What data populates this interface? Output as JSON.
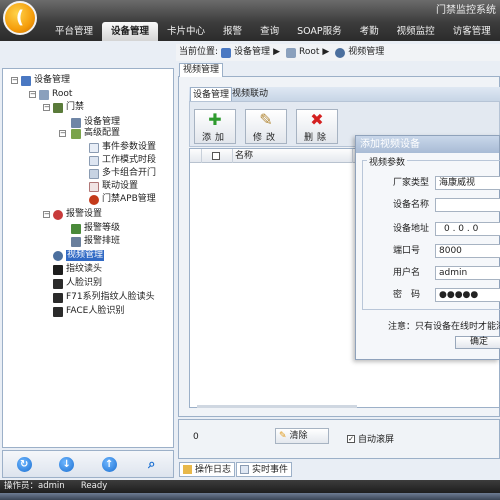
{
  "app": {
    "title": "门禁监控系统",
    "logo_glyph": "("
  },
  "menu": [
    "平台管理",
    "设备管理",
    "卡片中心",
    "报警",
    "查询",
    "SOAP服务",
    "考勤",
    "视频监控",
    "访客管理"
  ],
  "menu_active": "设备管理",
  "breadcrumb": {
    "prefix": "当前位置:",
    "items": [
      "设备管理",
      "Root",
      "视频管理"
    ]
  },
  "page_tab": "视频管理",
  "subtabs": [
    "设备管理",
    "视频联动"
  ],
  "toolbar": {
    "add_label": "添加",
    "edit_label": "修改",
    "delete_label": "删除"
  },
  "grid": {
    "columns": [
      "",
      "名称"
    ]
  },
  "tree": {
    "root_label": "设备管理",
    "items": [
      {
        "label": "Root"
      },
      {
        "label": "门禁"
      },
      {
        "label": "设备管理"
      },
      {
        "label": "高级配置"
      },
      {
        "label": "事件参数设置"
      },
      {
        "label": "工作模式时段"
      },
      {
        "label": "多卡组合开门"
      },
      {
        "label": "联动设置"
      },
      {
        "label": "门禁APB管理"
      },
      {
        "label": "报警设置"
      },
      {
        "label": "报警等级"
      },
      {
        "label": "报警排班"
      },
      {
        "label": "视频管理"
      },
      {
        "label": "指纹读头"
      },
      {
        "label": "人脸识别"
      },
      {
        "label": "F71系列指纹人脸读头"
      },
      {
        "label": "FACE人脸识别"
      }
    ],
    "selected": "视频管理"
  },
  "bottom": {
    "count": "0",
    "clear_label": "清除",
    "auto_scroll_label": "自动滚屏",
    "auto_scroll_checked": true
  },
  "log_tabs": [
    "操作日志",
    "实时事件"
  ],
  "status": {
    "operator_label": "操作员：admin",
    "state": "Ready"
  },
  "dialog": {
    "title": "添加视频设备",
    "group": "视频参数",
    "fields": [
      {
        "label": "厂家类型",
        "value": "海康威视"
      },
      {
        "label": "设备名称",
        "value": ""
      },
      {
        "label": "设备地址",
        "value": "0 . 0 . 0"
      },
      {
        "label": "端口号",
        "value": "8000"
      },
      {
        "label": "用户名",
        "value": "admin"
      },
      {
        "label": "密　码",
        "value": "●●●●●"
      }
    ],
    "note": "注意：只有设备在线时才能添",
    "ok_label": "确定"
  },
  "colors": {
    "accent": "#316ac5",
    "topbar": "#3c3c3c",
    "delete": "#d42020",
    "add": "#2e9a2e"
  }
}
